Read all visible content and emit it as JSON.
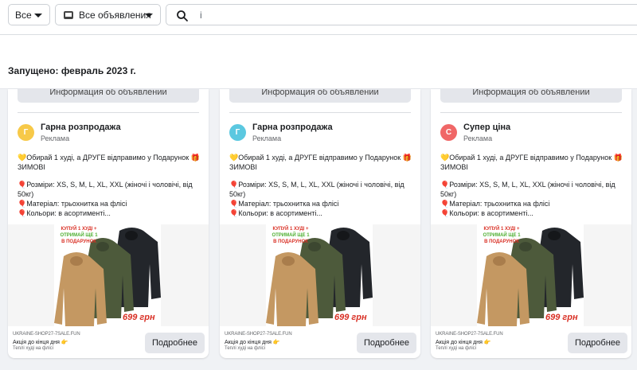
{
  "filters": {
    "scope_label": "Все",
    "ad_type_label": "Все объявления",
    "search_value": "і"
  },
  "launched": "Запущено: февраль 2023 г.",
  "cards": [
    {
      "info_button": "Информация об объявлении",
      "avatar_letter": "Г",
      "avatar_color": "#f7c948",
      "page_name": "Гарна розпродажа",
      "sponsored": "Реклама",
      "line1": "💛Обирай 1 худі, а ДРУГЕ відправимо у Подарунок 🎁ЗИМОВІ",
      "line2": "🎈Розміри: XS, S, M, L, XL, XXL (жіночі і чоловічі, від 50кг)",
      "line3": "🎈Матеріал: трьохнитка на флісі",
      "line4": "🎈Кольори: в асортименті...",
      "promo_top": "КУПУЙ 1 ХУДІ +",
      "promo_mid": "ОТРИМАЙ ЩЕ 1",
      "promo_bot": "В ПОДАРУНОК",
      "price": "699 грн",
      "domain": "UKRAINE-SHOP27-7SALE.FUN",
      "headline": "Акція до кінця дня 👉",
      "description": "Теплі худі на флісі",
      "cta": "Подробнее"
    },
    {
      "info_button": "Информация об объявлении",
      "avatar_letter": "Г",
      "avatar_color": "#5bc8e0",
      "page_name": "Гарна розпродажа",
      "sponsored": "Реклама",
      "line1": "💛Обирай 1 худі, а ДРУГЕ відправимо у Подарунок 🎁ЗИМОВІ",
      "line2": "🎈Розміри: XS, S, M, L, XL, XXL (жіночі і чоловічі, від 50кг)",
      "line3": "🎈Матеріал: трьохнитка на флісі",
      "line4": "🎈Кольори: в асортименті...",
      "promo_top": "КУПУЙ 1 ХУДІ +",
      "promo_mid": "ОТРИМАЙ ЩЕ 1",
      "promo_bot": "В ПОДАРУНОК",
      "price": "699 грн",
      "domain": "UKRAINE-SHOP27-7SALE.FUN",
      "headline": "Акція до кінця дня 👉",
      "description": "Теплі худі на флісі",
      "cta": "Подробнее"
    },
    {
      "info_button": "Информация об объявлении",
      "avatar_letter": "С",
      "avatar_color": "#f06767",
      "page_name": "Супер ціна",
      "sponsored": "Реклама",
      "line1": "💛Обирай 1 худі, а ДРУГЕ відправимо у Подарунок 🎁ЗИМОВІ",
      "line2": "🎈Розміри: XS, S, M, L, XL, XXL (жіночі і чоловічі, від 50кг)",
      "line3": "🎈Матеріал: трьохнитка на флісі",
      "line4": "🎈Кольори: в асортименті...",
      "promo_top": "КУПУЙ 1 ХУДІ +",
      "promo_mid": "ОТРИМАЙ ЩЕ 1",
      "promo_bot": "В ПОДАРУНОК",
      "price": "699 грн",
      "domain": "UKRAINE-SHOP27-7SALE.FUN",
      "headline": "Акція до кінця дня 👉",
      "description": "Теплі худі на флісі",
      "cta": "Подробнее"
    }
  ],
  "colors": {
    "hoodie_tan": "#c49862",
    "hoodie_olive": "#4d5a3b",
    "hoodie_black": "#23262b",
    "price_red": "#d93025"
  }
}
